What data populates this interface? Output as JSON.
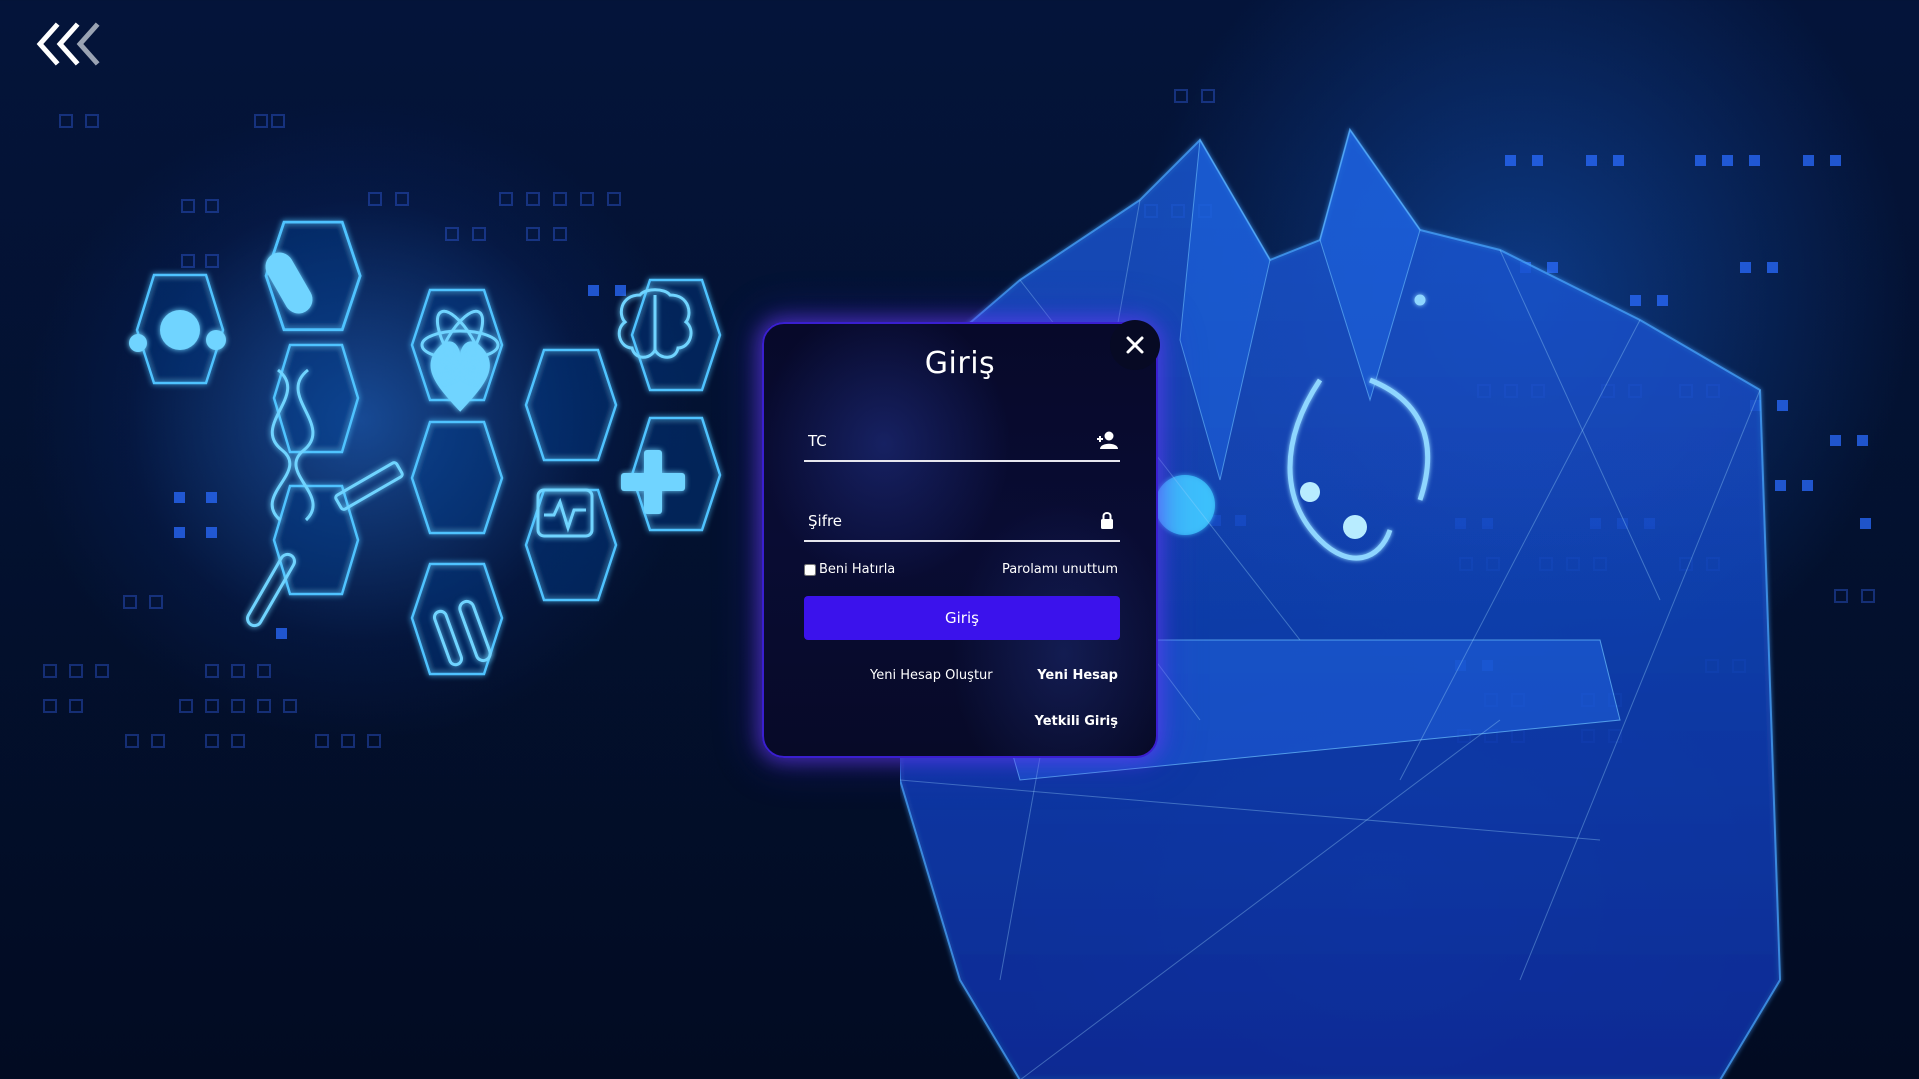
{
  "page": {
    "back_icon": "triple-chevron-left-icon"
  },
  "colors": {
    "background": "#04143a",
    "accent": "#3b12ec",
    "card_border": "#3a1fd0",
    "glow": "#2f8cff"
  },
  "login": {
    "title": "Giriş",
    "close_icon": "close-icon",
    "tc_placeholder": "TC",
    "tc_icon": "user-add-icon",
    "password_placeholder": "Şifre",
    "password_icon": "lock-icon",
    "remember_label": "Beni Hatırla",
    "forgot_label": "Parolamı unuttum",
    "submit_label": "Giriş",
    "create_account_label": "Yeni Hesap Oluştur",
    "new_account_label": "Yeni Hesap",
    "staff_login_label": "Yetkili Giriş"
  }
}
